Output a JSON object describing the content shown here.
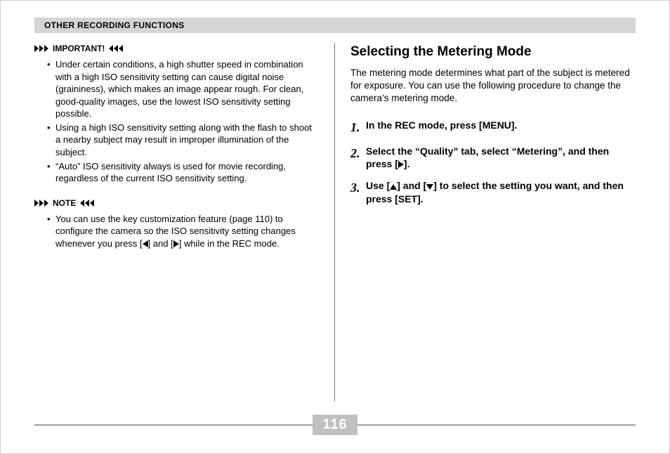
{
  "header": "OTHER RECORDING FUNCTIONS",
  "left": {
    "important_label": "IMPORTANT!",
    "important_items": [
      "Under certain conditions, a high shutter speed in combination with a high ISO sensitivity setting can cause digital noise (graininess), which makes an image appear rough. For clean, good-quality images, use the lowest ISO sensitivity setting possible.",
      "Using a high ISO sensitivity setting along with the flash to shoot a nearby subject may result in improper illumination of the subject.",
      "“Auto” ISO sensitivity always is used for movie recording, regardless of the current ISO sensitivity setting."
    ],
    "note_label": "NOTE",
    "note_items_pre": "You can use the key customization feature (page 110) to configure the camera so the ISO sensitivity setting changes whenever you press [",
    "note_items_mid": "] and [",
    "note_items_post": "] while in the REC mode."
  },
  "right": {
    "title": "Selecting the Metering Mode",
    "intro": "The metering mode determines what part of the subject is metered for exposure. You can use the following procedure to change the camera’s metering mode.",
    "steps": {
      "s1": "In the REC mode, press [MENU].",
      "s2_pre": "Select the “Quality” tab, select “Metering”, and then press [",
      "s2_post": "].",
      "s3_pre": "Use [",
      "s3_mid": "] and [",
      "s3_post": "] to select the setting you want, and then press [SET]."
    }
  },
  "page_number": "116"
}
